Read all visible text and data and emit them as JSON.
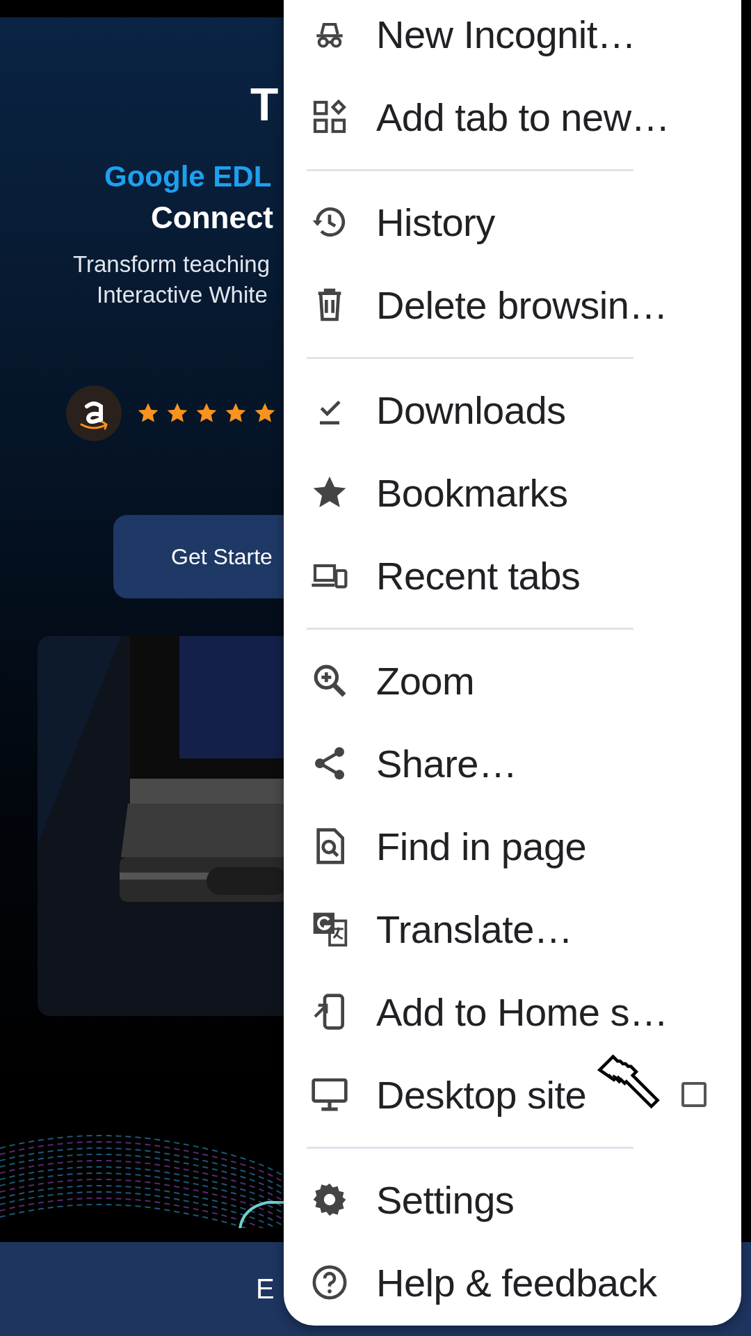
{
  "page": {
    "heading": "T",
    "brand_line": "Google EDL",
    "title_line": "Connect",
    "description_lines": [
      "Transform teaching",
      "Interactive White"
    ],
    "rating": {
      "stars": 5
    },
    "cta_button": "Get Starte",
    "product_image": {
      "kind": "picture"
    },
    "bottom_bar": {
      "label": "E"
    }
  },
  "menu": {
    "sections": [
      [
        {
          "kind": "item",
          "label": "New Incognit…"
        },
        {
          "kind": "item",
          "label": "Add tab to new…"
        }
      ],
      [
        {
          "kind": "item",
          "label": "History"
        },
        {
          "kind": "item",
          "label": "Delete browsin…"
        }
      ],
      [
        {
          "kind": "item",
          "label": "Downloads"
        },
        {
          "kind": "item",
          "label": "Bookmarks"
        },
        {
          "kind": "item",
          "label": "Recent tabs"
        }
      ],
      [
        {
          "kind": "item",
          "label": "Zoom"
        },
        {
          "kind": "item",
          "label": "Share…"
        },
        {
          "kind": "item",
          "label": "Find in page"
        },
        {
          "kind": "item",
          "label": "Translate…"
        },
        {
          "kind": "item",
          "label": "Add to Home s…"
        },
        {
          "kind": "checkbox",
          "label": "Desktop site",
          "checked": false
        }
      ],
      [
        {
          "kind": "item",
          "label": "Settings"
        },
        {
          "kind": "item",
          "label": "Help & feedback"
        }
      ]
    ]
  }
}
